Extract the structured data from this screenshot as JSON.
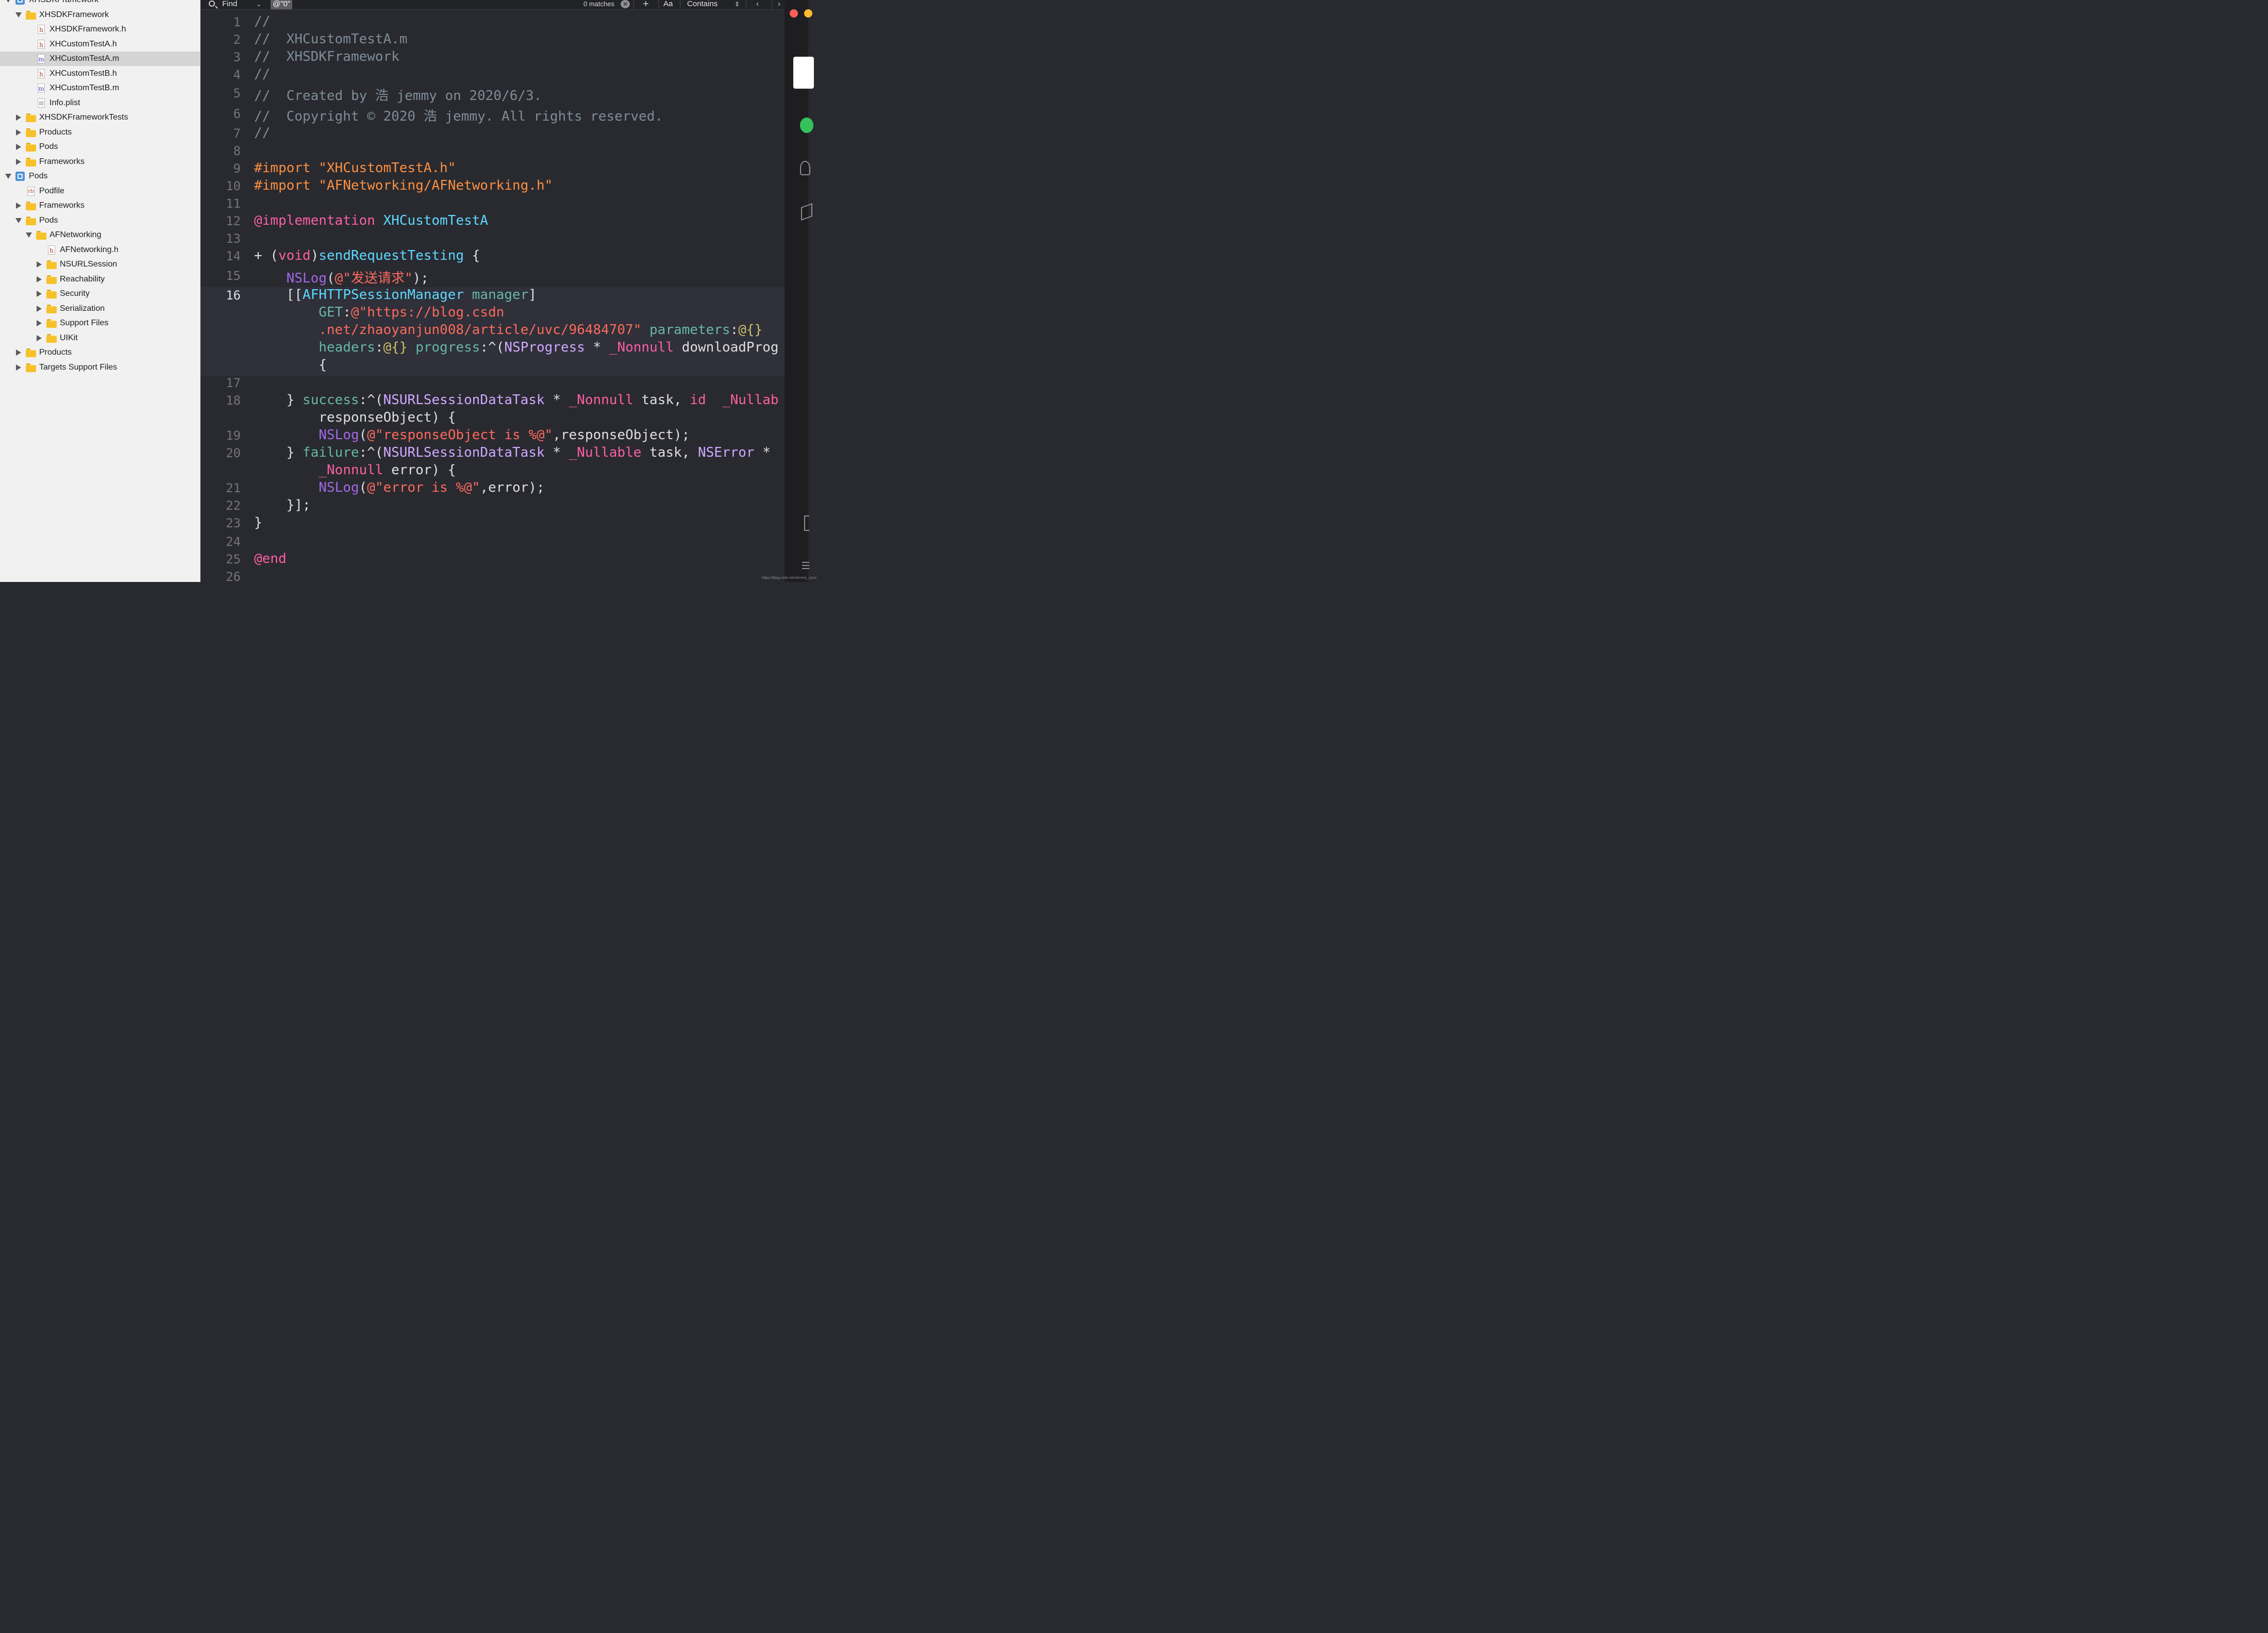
{
  "navigator": {
    "rows": [
      {
        "label": "XHSDKFramework",
        "indent": 0,
        "disclosure": "open",
        "icon": "project-icon",
        "kind": "project"
      },
      {
        "label": "XHSDKFramework",
        "indent": 1,
        "disclosure": "open",
        "icon": "folder-icon",
        "kind": "folder"
      },
      {
        "label": "XHSDKFramework.h",
        "indent": 2,
        "disclosure": "none",
        "icon": "header-file-icon",
        "kind": "h"
      },
      {
        "label": "XHCustomTestA.h",
        "indent": 2,
        "disclosure": "none",
        "icon": "header-file-icon",
        "kind": "h"
      },
      {
        "label": "XHCustomTestA.m",
        "indent": 2,
        "disclosure": "none",
        "icon": "implementation-file-icon",
        "kind": "m",
        "selected": true
      },
      {
        "label": "XHCustomTestB.h",
        "indent": 2,
        "disclosure": "none",
        "icon": "header-file-icon",
        "kind": "h"
      },
      {
        "label": "XHCustomTestB.m",
        "indent": 2,
        "disclosure": "none",
        "icon": "implementation-file-icon",
        "kind": "m"
      },
      {
        "label": "Info.plist",
        "indent": 2,
        "disclosure": "none",
        "icon": "plist-file-icon",
        "kind": "plist"
      },
      {
        "label": "XHSDKFrameworkTests",
        "indent": 1,
        "disclosure": "closed",
        "icon": "folder-icon",
        "kind": "folder"
      },
      {
        "label": "Products",
        "indent": 1,
        "disclosure": "closed",
        "icon": "folder-icon",
        "kind": "folder"
      },
      {
        "label": "Pods",
        "indent": 1,
        "disclosure": "closed",
        "icon": "folder-icon",
        "kind": "folder"
      },
      {
        "label": "Frameworks",
        "indent": 1,
        "disclosure": "closed",
        "icon": "folder-icon",
        "kind": "folder"
      },
      {
        "label": "Pods",
        "indent": 0,
        "disclosure": "open",
        "icon": "project-icon",
        "kind": "project"
      },
      {
        "label": "Podfile",
        "indent": 1,
        "disclosure": "none",
        "icon": "ruby-file-icon",
        "kind": "rb"
      },
      {
        "label": "Frameworks",
        "indent": 1,
        "disclosure": "closed",
        "icon": "folder-icon",
        "kind": "folder"
      },
      {
        "label": "Pods",
        "indent": 1,
        "disclosure": "open",
        "icon": "folder-icon",
        "kind": "folder"
      },
      {
        "label": "AFNetworking",
        "indent": 2,
        "disclosure": "open",
        "icon": "folder-icon",
        "kind": "folder"
      },
      {
        "label": "AFNetworking.h",
        "indent": 3,
        "disclosure": "none",
        "icon": "header-file-icon",
        "kind": "h"
      },
      {
        "label": "NSURLSession",
        "indent": 3,
        "disclosure": "closed",
        "icon": "folder-icon",
        "kind": "folder"
      },
      {
        "label": "Reachability",
        "indent": 3,
        "disclosure": "closed",
        "icon": "folder-icon",
        "kind": "folder"
      },
      {
        "label": "Security",
        "indent": 3,
        "disclosure": "closed",
        "icon": "folder-icon",
        "kind": "folder"
      },
      {
        "label": "Serialization",
        "indent": 3,
        "disclosure": "closed",
        "icon": "folder-icon",
        "kind": "folder"
      },
      {
        "label": "Support Files",
        "indent": 3,
        "disclosure": "closed",
        "icon": "folder-icon",
        "kind": "folder"
      },
      {
        "label": "UIKit",
        "indent": 3,
        "disclosure": "closed",
        "icon": "folder-icon",
        "kind": "folder"
      },
      {
        "label": "Products",
        "indent": 1,
        "disclosure": "closed",
        "icon": "folder-icon",
        "kind": "folder"
      },
      {
        "label": "Targets Support Files",
        "indent": 1,
        "disclosure": "closed",
        "icon": "folder-icon",
        "kind": "folder"
      }
    ]
  },
  "find_bar": {
    "mode_label": "Find",
    "query": "@\"0\"",
    "match_count": "0 matches",
    "case_label": "Aa",
    "match_mode": "Contains"
  },
  "editor": {
    "current_line": 16,
    "lines": [
      {
        "n": "1",
        "tokens": [
          [
            "//",
            "comment"
          ]
        ]
      },
      {
        "n": "2",
        "tokens": [
          [
            "//  XHCustomTestA.m",
            "comment"
          ]
        ]
      },
      {
        "n": "3",
        "tokens": [
          [
            "//  XHSDKFramework",
            "comment"
          ]
        ]
      },
      {
        "n": "4",
        "tokens": [
          [
            "//",
            "comment"
          ]
        ]
      },
      {
        "n": "5",
        "tokens": [
          [
            "//  Created by 浩 jemmy on 2020/6/3.",
            "comment"
          ]
        ]
      },
      {
        "n": "6",
        "tokens": [
          [
            "//  Copyright © 2020 浩 jemmy. All rights reserved.",
            "comment"
          ]
        ]
      },
      {
        "n": "7",
        "tokens": [
          [
            "//",
            "comment"
          ]
        ]
      },
      {
        "n": "8",
        "tokens": []
      },
      {
        "n": "9",
        "tokens": [
          [
            "#import ",
            "pre"
          ],
          [
            "\"XHCustomTestA.h\"",
            "pre"
          ]
        ]
      },
      {
        "n": "10",
        "tokens": [
          [
            "#import ",
            "pre"
          ],
          [
            "\"AFNetworking/AFNetworking.h\"",
            "pre"
          ]
        ]
      },
      {
        "n": "11",
        "tokens": []
      },
      {
        "n": "12",
        "tokens": [
          [
            "@implementation ",
            "kw"
          ],
          [
            "XHCustomTestA",
            "type"
          ]
        ]
      },
      {
        "n": "13",
        "tokens": []
      },
      {
        "n": "14",
        "tokens": [
          [
            "+ (",
            "plain"
          ],
          [
            "void",
            "kw"
          ],
          [
            ")",
            "plain"
          ],
          [
            "sendRequestTesting",
            "type"
          ],
          [
            " {",
            "plain"
          ]
        ]
      },
      {
        "n": "15",
        "tokens": [
          [
            "    ",
            "plain"
          ],
          [
            "NSLog",
            "meth"
          ],
          [
            "(",
            "plain"
          ],
          [
            "@\"发送请求\"",
            "str"
          ],
          [
            ");",
            "plain"
          ]
        ]
      },
      {
        "n": "16",
        "tokens": [
          [
            "    [[",
            "plain"
          ],
          [
            "AFHTTPSessionManager",
            "type"
          ],
          [
            " ",
            "plain"
          ],
          [
            "manager",
            "fn"
          ],
          [
            "]",
            "plain"
          ]
        ]
      },
      {
        "n": "",
        "tokens": [
          [
            "        ",
            "plain"
          ],
          [
            "GET",
            "fn"
          ],
          [
            ":",
            "plain"
          ],
          [
            "@\"https://blog.csdn",
            "str"
          ]
        ]
      },
      {
        "n": "",
        "tokens": [
          [
            "        ",
            "plain"
          ],
          [
            ".net/zhaoyanjun008/article/uvc/96484707\"",
            "str"
          ],
          [
            " ",
            "plain"
          ],
          [
            "parameters",
            "fn"
          ],
          [
            ":",
            "plain"
          ],
          [
            "@{}",
            "num"
          ]
        ]
      },
      {
        "n": "",
        "tokens": [
          [
            "        ",
            "plain"
          ],
          [
            "headers",
            "fn"
          ],
          [
            ":",
            "plain"
          ],
          [
            "@{}",
            "num"
          ],
          [
            " ",
            "plain"
          ],
          [
            "progress",
            "fn"
          ],
          [
            ":^(",
            "plain"
          ],
          [
            "NSProgress",
            "class"
          ],
          [
            " * ",
            "plain"
          ],
          [
            "_Nonnull",
            "kw"
          ],
          [
            " downloadProg",
            "plain"
          ]
        ]
      },
      {
        "n": "",
        "tokens": [
          [
            "        {",
            "plain"
          ]
        ]
      },
      {
        "n": "17",
        "tokens": []
      },
      {
        "n": "18",
        "tokens": [
          [
            "    } ",
            "plain"
          ],
          [
            "success",
            "fn"
          ],
          [
            ":^(",
            "plain"
          ],
          [
            "NSURLSessionDataTask",
            "class"
          ],
          [
            " * ",
            "plain"
          ],
          [
            "_Nonnull",
            "kw"
          ],
          [
            " task, ",
            "plain"
          ],
          [
            "id",
            "kw"
          ],
          [
            "  ",
            "plain"
          ],
          [
            "_Nullab",
            "kw"
          ]
        ]
      },
      {
        "n": "",
        "tokens": [
          [
            "        responseObject) {",
            "plain"
          ]
        ]
      },
      {
        "n": "19",
        "tokens": [
          [
            "        ",
            "plain"
          ],
          [
            "NSLog",
            "meth"
          ],
          [
            "(",
            "plain"
          ],
          [
            "@\"responseObject is %@\"",
            "str"
          ],
          [
            ",responseObject);",
            "plain"
          ]
        ]
      },
      {
        "n": "20",
        "tokens": [
          [
            "    } ",
            "plain"
          ],
          [
            "failure",
            "fn"
          ],
          [
            ":^(",
            "plain"
          ],
          [
            "NSURLSessionDataTask",
            "class"
          ],
          [
            " * ",
            "plain"
          ],
          [
            "_Nullable",
            "kw"
          ],
          [
            " task, ",
            "plain"
          ],
          [
            "NSError",
            "class"
          ],
          [
            " *",
            "plain"
          ]
        ]
      },
      {
        "n": "",
        "tokens": [
          [
            "        ",
            "plain"
          ],
          [
            "_Nonnull",
            "kw"
          ],
          [
            " error) {",
            "plain"
          ]
        ]
      },
      {
        "n": "21",
        "tokens": [
          [
            "        ",
            "plain"
          ],
          [
            "NSLog",
            "meth"
          ],
          [
            "(",
            "plain"
          ],
          [
            "@\"error is %@\"",
            "str"
          ],
          [
            ",error);",
            "plain"
          ]
        ]
      },
      {
        "n": "22",
        "tokens": [
          [
            "    }];",
            "plain"
          ]
        ]
      },
      {
        "n": "23",
        "tokens": [
          [
            "}",
            "plain"
          ]
        ]
      },
      {
        "n": "24",
        "tokens": []
      },
      {
        "n": "25",
        "tokens": [
          [
            "@end",
            "kw"
          ]
        ]
      },
      {
        "n": "26",
        "tokens": []
      }
    ]
  },
  "watermark": "https://blog.csdn.net/Jemmy_coco",
  "colors": {
    "editor_bg": "#292a30",
    "comment": "#7f8c98",
    "keyword": "#fc5fa3",
    "string": "#fc6a5d",
    "preprocessor": "#fd8f3f",
    "type": "#5dd8ff",
    "class": "#d0a8ff",
    "function": "#67b7a4",
    "selection": "#d4d4d4"
  }
}
